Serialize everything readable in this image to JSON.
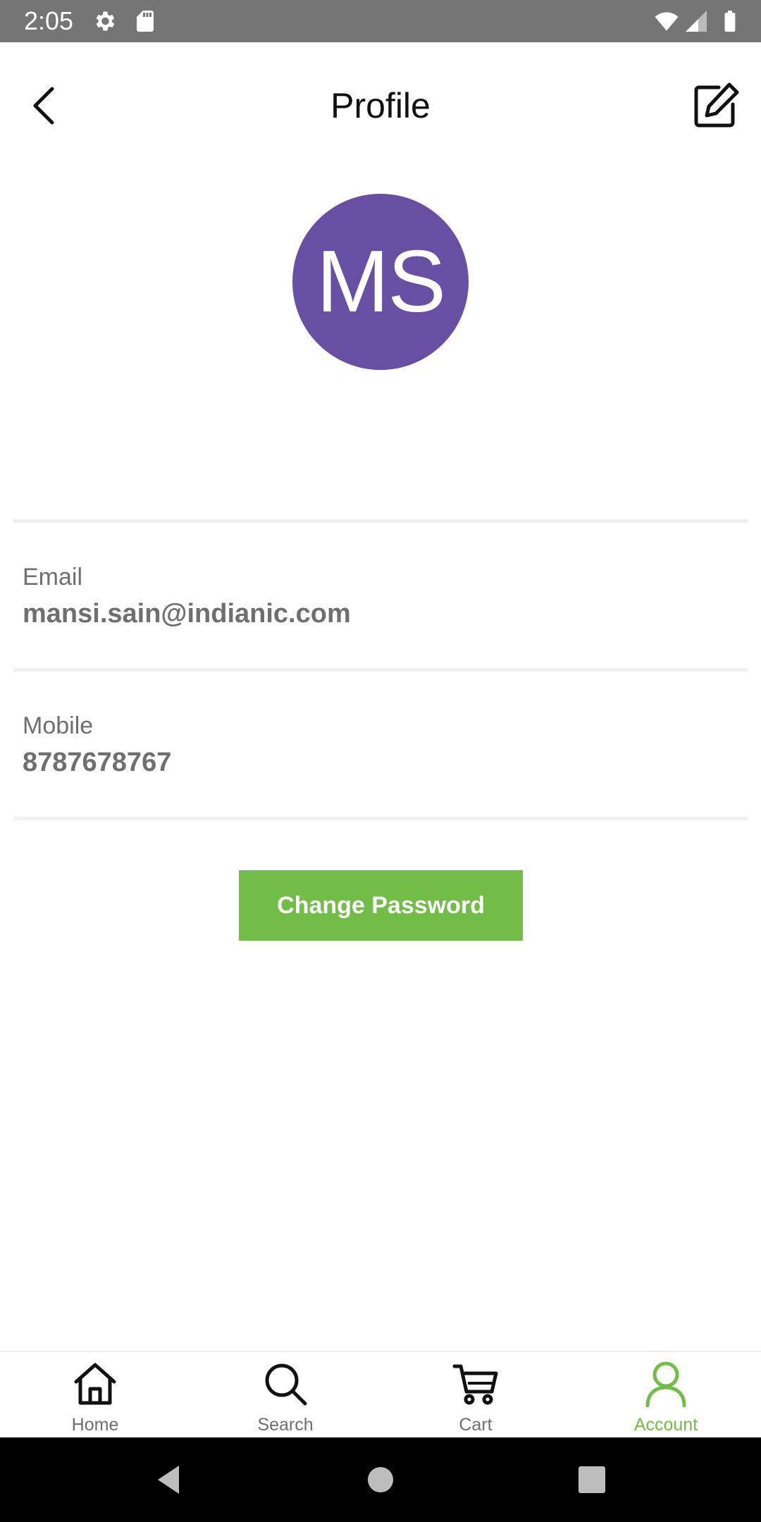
{
  "status_bar": {
    "time": "2:05",
    "icons": [
      "settings-icon",
      "sd-card-icon",
      "wifi-icon",
      "signal-icon",
      "battery-icon"
    ]
  },
  "header": {
    "title": "Profile",
    "back_icon": "chevron-left-icon",
    "edit_icon": "edit-icon"
  },
  "profile": {
    "initials": "MS",
    "avatar_color": "#6750a4",
    "email_label": "Email",
    "email_value": "mansi.sain@indianic.com",
    "mobile_label": "Mobile",
    "mobile_value": "8787678767"
  },
  "actions": {
    "change_password_label": "Change Password",
    "button_color": "#72bc48"
  },
  "bottom_nav": {
    "active_color": "#72bc48",
    "items": [
      {
        "label": "Home",
        "icon": "home-icon"
      },
      {
        "label": "Search",
        "icon": "search-icon"
      },
      {
        "label": "Cart",
        "icon": "cart-icon"
      },
      {
        "label": "Account",
        "icon": "account-icon",
        "active": true
      }
    ]
  },
  "system_nav": {
    "buttons": [
      "back-triangle-icon",
      "home-circle-icon",
      "recents-square-icon"
    ]
  }
}
